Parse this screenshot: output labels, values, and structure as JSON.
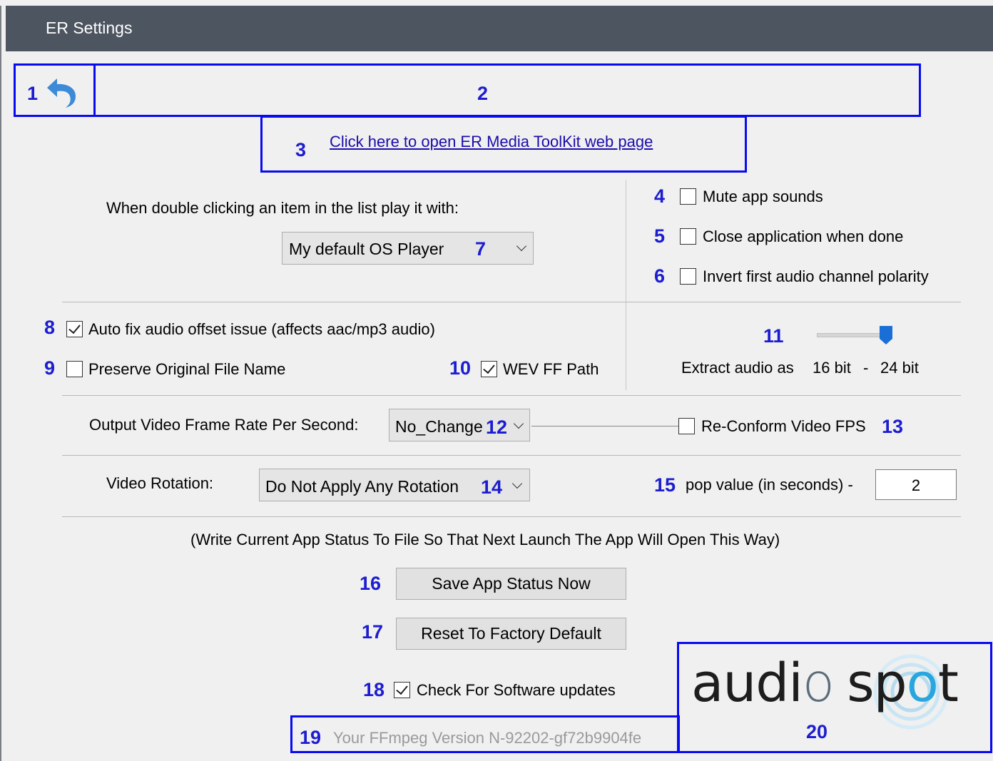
{
  "window": {
    "title": "ER Settings"
  },
  "annotations": {
    "n1": "1",
    "n2": "2",
    "n3": "3",
    "n4": "4",
    "n5": "5",
    "n6": "6",
    "n7": "7",
    "n8": "8",
    "n9": "9",
    "n10": "10",
    "n11": "11",
    "n12": "12",
    "n13": "13",
    "n14": "14",
    "n15": "15",
    "n16": "16",
    "n17": "17",
    "n18": "18",
    "n19": "19",
    "n20": "20"
  },
  "header": {
    "web_link": "Click here to open ER Media ToolKit web page"
  },
  "player": {
    "label": "When double clicking an item in the list play it with:",
    "selected": "My default OS Player"
  },
  "options": {
    "mute": {
      "label": "Mute app sounds",
      "checked": false
    },
    "close_when_done": {
      "label": "Close application when done",
      "checked": false
    },
    "invert_polarity": {
      "label": "Invert first audio channel polarity",
      "checked": false
    },
    "auto_fix_offset": {
      "label": "Auto fix audio offset issue (affects aac/mp3 audio)",
      "checked": true
    },
    "preserve_name": {
      "label": "Preserve Original File Name",
      "checked": false
    },
    "wev_ff_path": {
      "label": "WEV FF Path",
      "checked": true
    },
    "reconform_fps": {
      "label": "Re-Conform Video FPS",
      "checked": false
    },
    "check_updates": {
      "label": "Check For Software updates",
      "checked": true
    }
  },
  "extract_audio": {
    "label": "Extract audio as",
    "low": "16 bit",
    "sep": "-",
    "high": "24 bit",
    "slider_level": 1.0
  },
  "frame_rate": {
    "label": "Output Video Frame Rate Per Second:",
    "selected": "No_Change"
  },
  "rotation": {
    "label": "Video Rotation:",
    "selected": "Do Not Apply Any Rotation"
  },
  "pop": {
    "label": "pop value (in seconds) -",
    "value": "2"
  },
  "status": {
    "note": "(Write Current App Status To File So That Next Launch The App Will Open This Way)",
    "save_button": "Save App Status Now",
    "reset_button": "Reset To Factory Default"
  },
  "ffmpeg": {
    "version_text": "Your FFmpeg Version N-92202-gf72b9904fe"
  },
  "logo": {
    "word1": "audi",
    "o1": "o",
    "word2": "sp",
    "o2": "o",
    "word3": "t"
  },
  "colors": {
    "annotation": "#1c1cd0",
    "titlebar": "#4d5560",
    "slider": "#1a6fd6",
    "link": "#1a0dab"
  }
}
